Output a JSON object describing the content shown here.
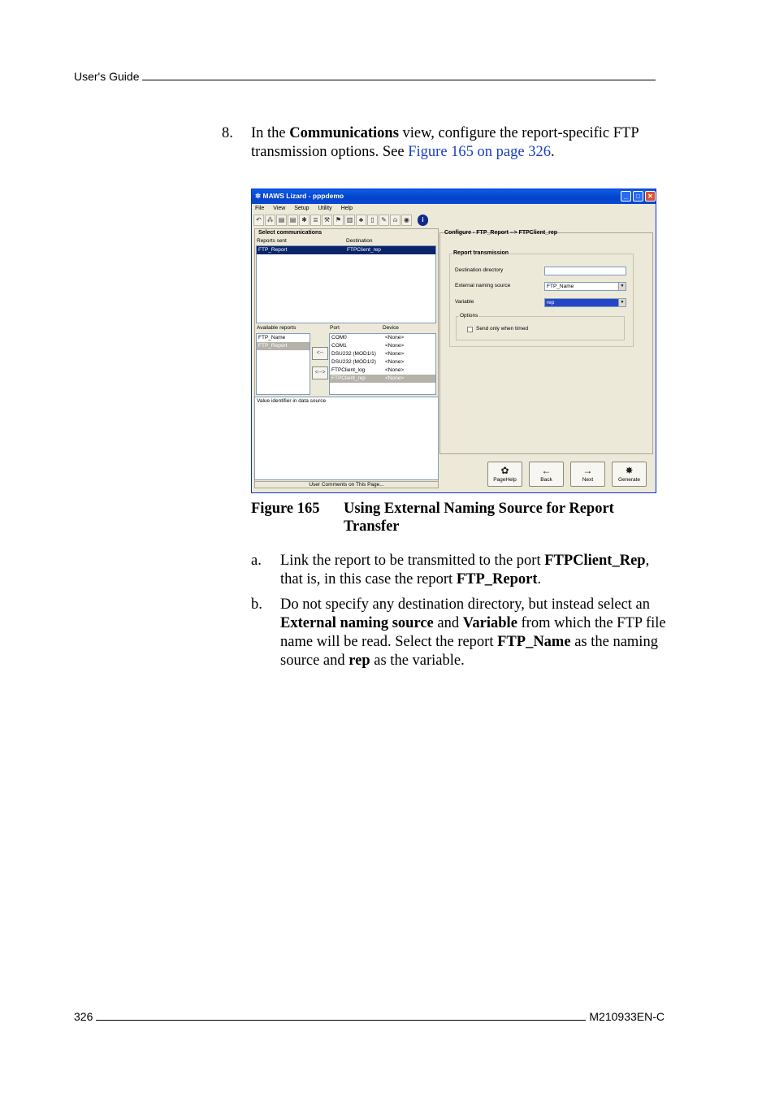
{
  "header": {
    "title": "User's Guide"
  },
  "footer": {
    "page_number": "326",
    "doc_code": "M210933EN-C"
  },
  "step8": {
    "number": "8.",
    "text_1": "In the ",
    "bold_1": "Communications",
    "text_2": " view, configure the report-specific FTP transmission options. See ",
    "link": "Figure 165 on page 326",
    "text_3": "."
  },
  "app": {
    "title": "MAWS Lizard - pppdemo",
    "menu": [
      "File",
      "View",
      "Setup",
      "Utility",
      "Help"
    ],
    "toolbar_icons": [
      "undo-icon",
      "network-icon",
      "sensor-icon",
      "sensor2-icon",
      "flag-icon",
      "list-icon",
      "tools-icon",
      "chart-icon",
      "page-icon",
      "hierarchy-icon",
      "doc-icon",
      "link-icon",
      "bell-icon",
      "disk-icon",
      "info-icon"
    ],
    "left": {
      "section_title": "Select communications",
      "col_reports_sent": "Reports sent",
      "col_destination": "Destination",
      "sent_rows": [
        {
          "report": "FTP_Report",
          "destination": "FTPClient_rep"
        }
      ],
      "available_label": "Available reports",
      "port_label": "Port",
      "device_label": "Device",
      "available_reports": [
        "FTP_Name",
        "FTP_Report"
      ],
      "arrow_disabled": "<--",
      "arrow_enabled": "<-->",
      "ports": [
        {
          "port": "COM0",
          "device": "<None>"
        },
        {
          "port": "COM1",
          "device": "<None>"
        },
        {
          "port": "DSU232 (MOD1/1)",
          "device": "<None>"
        },
        {
          "port": "DSU232 (MOD1/2)",
          "device": "<None>"
        },
        {
          "port": "FTPClient_log",
          "device": "<None>"
        },
        {
          "port": "FTPClient_rep",
          "device": "<None>"
        }
      ],
      "info_text": "Value identifier in data source",
      "comments_label": "User Comments on This Page..."
    },
    "right": {
      "configure_title": "Configure - FTP_Report --> FTPClient_rep",
      "group_title": "Report transmission",
      "dest_dir_label": "Destination directory",
      "dest_dir_value": "",
      "ext_naming_label": "External naming source",
      "ext_naming_value": "FTP_Name",
      "variable_label": "Variable",
      "variable_value": "rep",
      "options_label": "Options",
      "send_only_label": "Send only when timed"
    },
    "buttons": [
      {
        "label": "PageHelp",
        "icon": "pagehelp-icon",
        "glyph": "✿"
      },
      {
        "label": "Back",
        "icon": "back-arrow-icon",
        "glyph": "←"
      },
      {
        "label": "Next",
        "icon": "next-arrow-icon",
        "glyph": "→"
      },
      {
        "label": "Generate",
        "icon": "generate-icon",
        "glyph": "✸"
      }
    ]
  },
  "figure": {
    "label": "Figure 165",
    "title": "Using External Naming Source for Report Transfer"
  },
  "item_a": {
    "marker": "a.",
    "t1": "Link the report to be transmitted to the port ",
    "b1": "FTPClient_Rep",
    "t2": ", that is, in this case the report ",
    "b2": "FTP_Report",
    "t3": "."
  },
  "item_b": {
    "marker": "b.",
    "t1": "Do not specify any destination directory, but instead select an ",
    "b1": "External naming source",
    "t2": " and ",
    "b2": "Variable",
    "t3": " from which the FTP file name will be read. Select the report ",
    "b3": "FTP_Name",
    "t4": " as the naming source and ",
    "b4": "rep",
    "t5": " as the variable."
  }
}
